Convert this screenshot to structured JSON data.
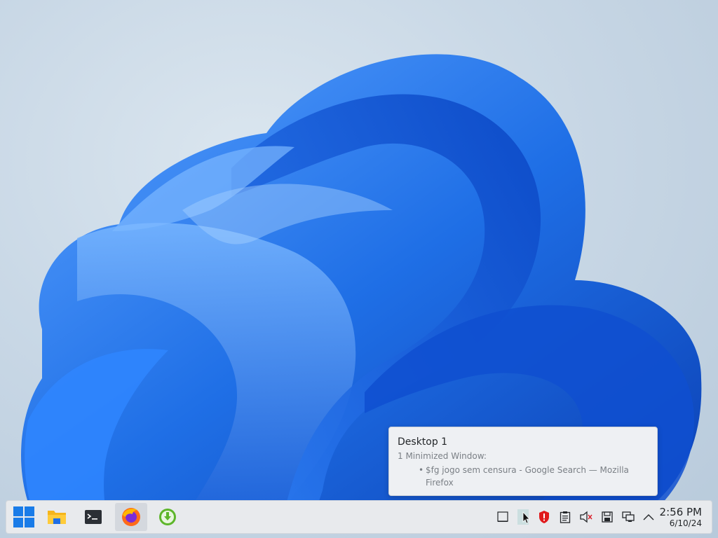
{
  "desktop": {
    "tooltip": {
      "title": "Desktop 1",
      "subtitle": "1 Minimized Window:",
      "bullet": "•",
      "window_line1": "$fg jogo sem censura - Google Search — Mozilla",
      "window_line2": "Firefox"
    }
  },
  "taskbar": {
    "launchers": [
      {
        "name": "start-menu",
        "icon": "windows-logo-icon"
      },
      {
        "name": "file-manager",
        "icon": "folder-icon"
      },
      {
        "name": "terminal",
        "icon": "terminal-icon"
      },
      {
        "name": "firefox",
        "icon": "firefox-icon",
        "active": true
      },
      {
        "name": "downloader",
        "icon": "download-icon"
      }
    ],
    "tray": [
      "show-desktop-icon",
      "virtual-desktop-icon",
      "security-shield-icon",
      "clipboard-icon",
      "volume-muted-icon",
      "save-icon",
      "network-icon",
      "chevron-up-icon"
    ],
    "clock": {
      "time": "2:56 PM",
      "date": "6/10/24"
    }
  },
  "colors": {
    "accent": "#1f6fe6",
    "shield": "#e0191c",
    "download": "#5db62a"
  }
}
